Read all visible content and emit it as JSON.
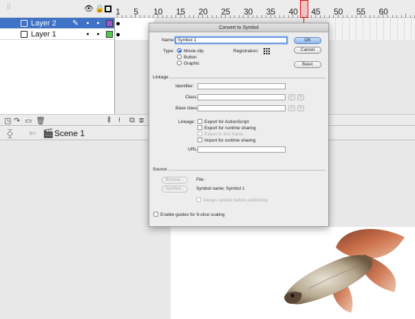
{
  "timeline": {
    "ruler_numbers": [
      "1",
      "5",
      "10",
      "15",
      "20",
      "25",
      "30",
      "35",
      "40",
      "45",
      "50",
      "55",
      "60"
    ],
    "playhead_frame": 40,
    "layers": [
      {
        "name": "Layer 2",
        "selected": true,
        "color": "#9b59d0"
      },
      {
        "name": "Layer 1",
        "selected": false,
        "color": "#4fc94a"
      }
    ],
    "scene_name": "Scene 1"
  },
  "dialog": {
    "title": "Convert to Symbol",
    "name_label": "Name:",
    "name_value": "Symbol 1",
    "type_label": "Type:",
    "type_options": [
      "Movie clip",
      "Button",
      "Graphic"
    ],
    "type_selected": "Movie clip",
    "registration_label": "Registration:",
    "ok_label": "OK",
    "cancel_label": "Cancel",
    "basic_label": "Basic",
    "linkage_section": "Linkage",
    "identifier_label": "Identifier:",
    "class_label": "Class:",
    "base_class_label": "Base class:",
    "linkage_label": "Linkage:",
    "linkage_options": [
      "Export for ActionScript",
      "Export for runtime sharing",
      "Export in first frame",
      "Import for runtime sharing"
    ],
    "url_label": "URL:",
    "source_section": "Source",
    "browse_label": "Browse...",
    "file_label": "File:",
    "symbol_button_label": "Symbol...",
    "symbol_name_text": "Symbol name: Symbol 1",
    "always_update_label": "Always update before publishing",
    "nine_slice_label": "Enable guides for 9-slice scaling"
  }
}
